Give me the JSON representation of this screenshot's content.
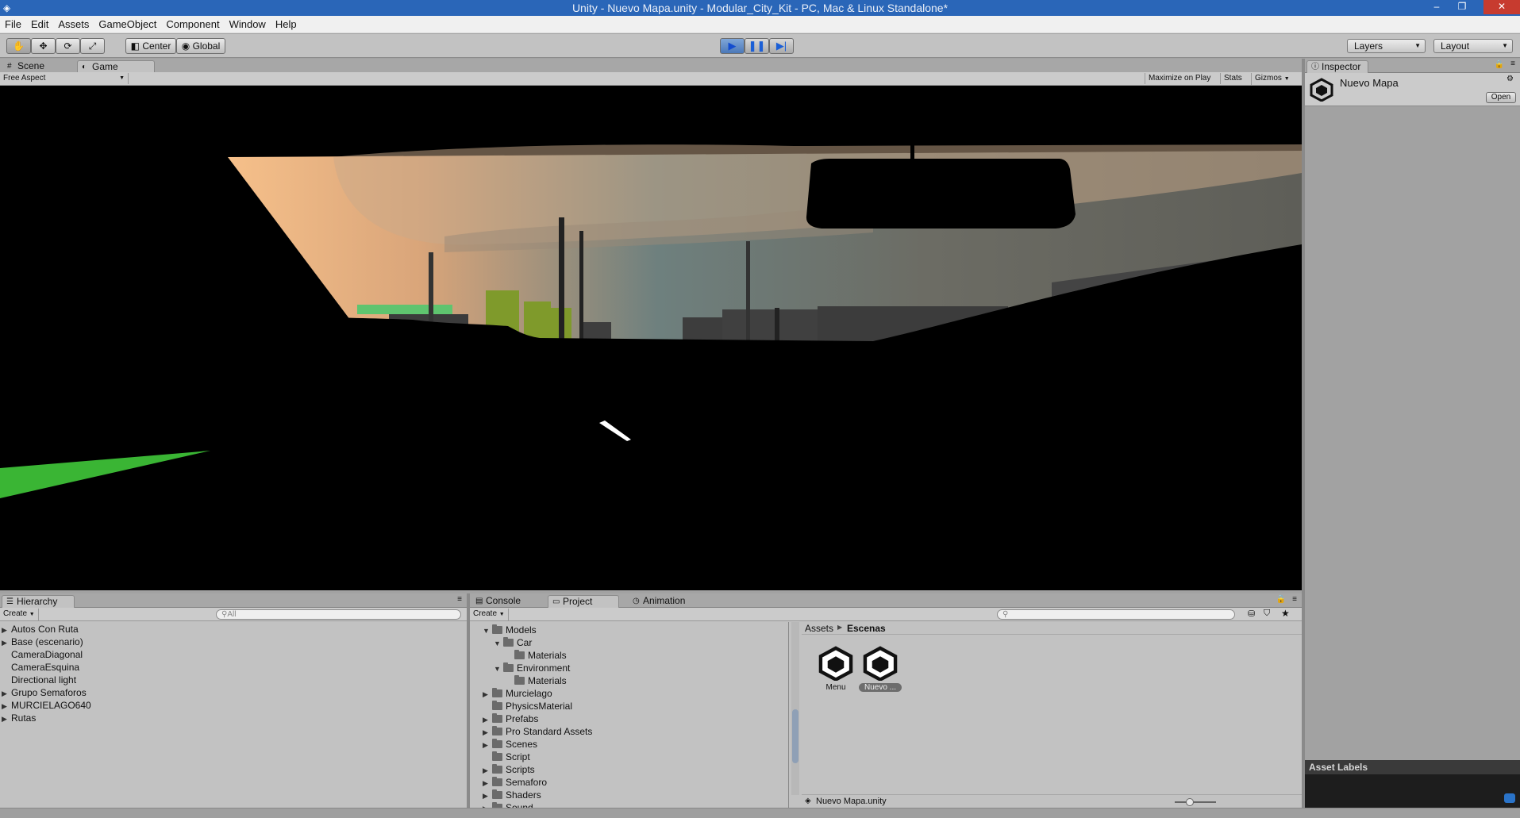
{
  "window": {
    "title": "Unity - Nuevo Mapa.unity - Modular_City_Kit - PC, Mac & Linux Standalone*"
  },
  "menu": [
    "File",
    "Edit",
    "Assets",
    "GameObject",
    "Component",
    "Window",
    "Help"
  ],
  "toolbar": {
    "pivot_label": "Center",
    "space_label": "Global",
    "layers_label": "Layers",
    "layout_label": "Layout"
  },
  "scene_tabs": {
    "scene": "Scene",
    "game": "Game"
  },
  "game_bar": {
    "aspect": "Free Aspect",
    "maximize": "Maximize on Play",
    "stats": "Stats",
    "gizmos": "Gizmos"
  },
  "inspector": {
    "tab": "Inspector",
    "asset_name": "Nuevo Mapa",
    "open_button": "Open",
    "asset_labels": "Asset Labels"
  },
  "hierarchy": {
    "tab": "Hierarchy",
    "create": "Create",
    "search_placeholder": "All",
    "items": [
      {
        "label": "Autos Con Ruta",
        "expandable": true
      },
      {
        "label": "Base (escenario)",
        "expandable": true
      },
      {
        "label": "CameraDiagonal",
        "expandable": false
      },
      {
        "label": "CameraEsquina",
        "expandable": false
      },
      {
        "label": "Directional light",
        "expandable": false
      },
      {
        "label": "Grupo Semaforos",
        "expandable": true
      },
      {
        "label": "MURCIELAGO640",
        "expandable": true
      },
      {
        "label": "Rutas",
        "expandable": true
      }
    ]
  },
  "project": {
    "tabs": {
      "console": "Console",
      "project": "Project",
      "animation": "Animation"
    },
    "create": "Create",
    "tree": [
      {
        "label": "Models",
        "depth": 0,
        "arrow": "open"
      },
      {
        "label": "Car",
        "depth": 1,
        "arrow": "open"
      },
      {
        "label": "Materials",
        "depth": 2,
        "arrow": "none"
      },
      {
        "label": "Environment",
        "depth": 1,
        "arrow": "open"
      },
      {
        "label": "Materials",
        "depth": 2,
        "arrow": "none"
      },
      {
        "label": "Murcielago",
        "depth": 0,
        "arrow": "closed"
      },
      {
        "label": "PhysicsMaterial",
        "depth": 0,
        "arrow": "none"
      },
      {
        "label": "Prefabs",
        "depth": 0,
        "arrow": "closed"
      },
      {
        "label": "Pro Standard Assets",
        "depth": 0,
        "arrow": "closed"
      },
      {
        "label": "Scenes",
        "depth": 0,
        "arrow": "closed"
      },
      {
        "label": "Script",
        "depth": 0,
        "arrow": "none"
      },
      {
        "label": "Scripts",
        "depth": 0,
        "arrow": "closed"
      },
      {
        "label": "Semaforo",
        "depth": 0,
        "arrow": "closed"
      },
      {
        "label": "Shaders",
        "depth": 0,
        "arrow": "closed"
      },
      {
        "label": "Sound",
        "depth": 0,
        "arrow": "closed"
      }
    ],
    "breadcrumb": {
      "root": "Assets",
      "current": "Escenas"
    },
    "assets": [
      {
        "label": "Menu",
        "selected": false
      },
      {
        "label": "Nuevo ...",
        "selected": true
      }
    ],
    "selected_path": "Nuevo Mapa.unity"
  },
  "colors": {
    "titlebar": "#2a66b8",
    "panel": "#c2c2c2",
    "play_active": "#4b78b8"
  }
}
